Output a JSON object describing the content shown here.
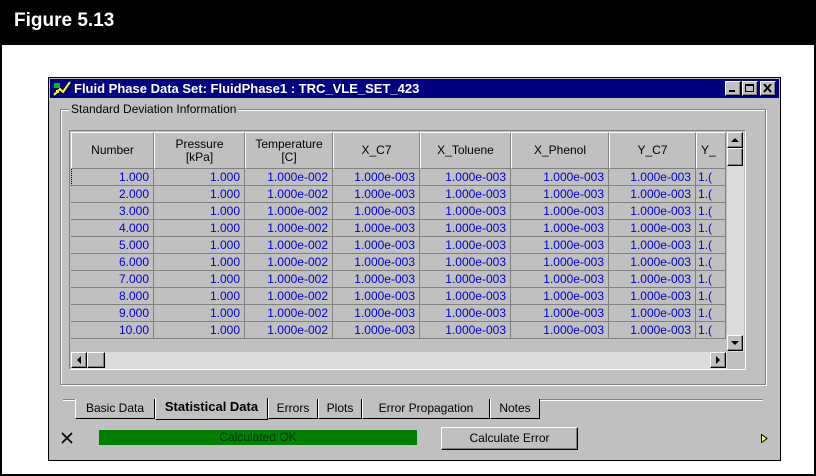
{
  "figure": {
    "title": "Figure 5.13"
  },
  "window": {
    "title": "Fluid Phase Data Set: FluidPhase1 : TRC_VLE_SET_423"
  },
  "group": {
    "label": "Standard Deviation Information"
  },
  "table": {
    "headers": [
      "Number",
      "Pressure\n[kPa]",
      "Temperature\n[C]",
      "X_C7",
      "X_Toluene",
      "X_Phenol",
      "Y_C7",
      "Y_"
    ],
    "rows": [
      [
        "1.000",
        "1.000",
        "1.000e-002",
        "1.000e-003",
        "1.000e-003",
        "1.000e-003",
        "1.000e-003",
        "1.("
      ],
      [
        "2.000",
        "1.000",
        "1.000e-002",
        "1.000e-003",
        "1.000e-003",
        "1.000e-003",
        "1.000e-003",
        "1.("
      ],
      [
        "3.000",
        "1.000",
        "1.000e-002",
        "1.000e-003",
        "1.000e-003",
        "1.000e-003",
        "1.000e-003",
        "1.("
      ],
      [
        "4.000",
        "1.000",
        "1.000e-002",
        "1.000e-003",
        "1.000e-003",
        "1.000e-003",
        "1.000e-003",
        "1.("
      ],
      [
        "5.000",
        "1.000",
        "1.000e-002",
        "1.000e-003",
        "1.000e-003",
        "1.000e-003",
        "1.000e-003",
        "1.("
      ],
      [
        "6.000",
        "1.000",
        "1.000e-002",
        "1.000e-003",
        "1.000e-003",
        "1.000e-003",
        "1.000e-003",
        "1.("
      ],
      [
        "7.000",
        "1.000",
        "1.000e-002",
        "1.000e-003",
        "1.000e-003",
        "1.000e-003",
        "1.000e-003",
        "1.("
      ],
      [
        "8.000",
        "1.000",
        "1.000e-002",
        "1.000e-003",
        "1.000e-003",
        "1.000e-003",
        "1.000e-003",
        "1.("
      ],
      [
        "9.000",
        "1.000",
        "1.000e-002",
        "1.000e-003",
        "1.000e-003",
        "1.000e-003",
        "1.000e-003",
        "1.("
      ],
      [
        "10.00",
        "1.000",
        "1.000e-002",
        "1.000e-003",
        "1.000e-003",
        "1.000e-003",
        "1.000e-003",
        "1.("
      ]
    ]
  },
  "tabs": [
    {
      "label": "Basic Data",
      "active": false
    },
    {
      "label": "Statistical Data",
      "active": true
    },
    {
      "label": "Errors",
      "active": false
    },
    {
      "label": "Plots",
      "active": false
    },
    {
      "label": "Error Propagation",
      "active": false
    },
    {
      "label": "Notes",
      "active": false
    }
  ],
  "status": {
    "icon": "close-icon",
    "text": "Calculated OK",
    "color": "#008000"
  },
  "calculate_button": {
    "label": "Calculate Error"
  },
  "colors": {
    "titlebar": "#000080",
    "cell_text": "#0000d0",
    "face": "#c0c0c0"
  }
}
